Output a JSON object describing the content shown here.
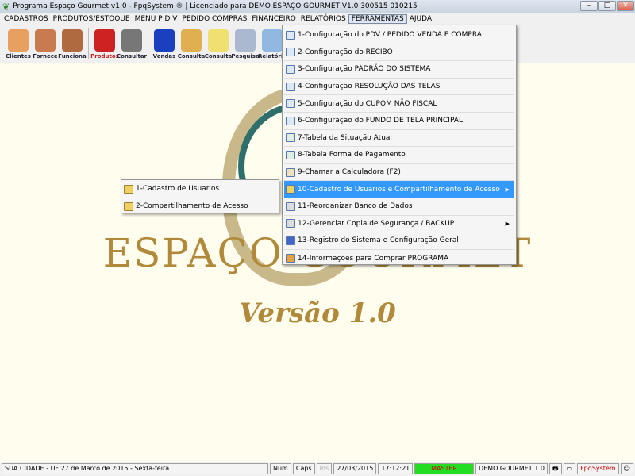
{
  "window": {
    "title": "Programa Espaço Gourmet v1.0 - FpqSystem ® | Licenciado para  DEMO ESPAÇO GOURMET V1.0 300515 010215",
    "min": "–",
    "max": "□",
    "close": "✕"
  },
  "menubar": [
    "CADASTROS",
    "PRODUTOS/ESTOQUE",
    "MENU P D V",
    "PEDIDO COMPRAS",
    "FINANCEIRO",
    "RELATÓRIOS",
    "FERRAMENTAS",
    "AJUDA"
  ],
  "toolbar": [
    {
      "label": "Clientes",
      "color": "#e8a060"
    },
    {
      "label": "Fornece",
      "color": "#c87a50"
    },
    {
      "label": "Funciona",
      "color": "#b06a40"
    },
    {
      "label": "Produtos",
      "color": "#cc2222"
    },
    {
      "label": "Consultar",
      "color": "#777777"
    },
    {
      "label": "Vendas",
      "color": "#1a3fbf"
    },
    {
      "label": "Consulta",
      "color": "#e0b050"
    },
    {
      "label": "Consulta",
      "color": "#f0e070"
    },
    {
      "label": "Pesquisa",
      "color": "#aab8d0"
    },
    {
      "label": "Relatório",
      "color": "#90b8e0"
    }
  ],
  "ferramentas_menu": [
    {
      "label": "1-Configuração do PDV / PEDIDO VENDA E COMPRA"
    },
    {
      "label": "2-Configuração do RECIBO"
    },
    {
      "label": "3-Configuração PADRÃO DO SISTEMA"
    },
    {
      "label": "4-Configuração RESOLUÇÃO DAS TELAS"
    },
    {
      "label": "5-Configuração do CUPOM NÃO FISCAL"
    },
    {
      "label": "6-Configuração do FUNDO DE TELA PRINCIPAL"
    },
    {
      "label": "7-Tabela da Situação Atual"
    },
    {
      "label": "8-Tabela Forma de Pagamento"
    },
    {
      "label": "9-Chamar a Calculadora (F2)"
    },
    {
      "label": "10-Cadastro de Usuarios e Compartilhamento de Acesso",
      "submenu": true,
      "highlighted": true
    },
    {
      "label": "11-Reorganizar Banco de Dados"
    },
    {
      "label": "12-Gerenciar Copia de Segurança / BACKUP",
      "submenu": true
    },
    {
      "label": "13-Registro do Sistema e Configuração Geral"
    },
    {
      "label": "14-Informações para Comprar PROGRAMA"
    }
  ],
  "submenu": [
    "1-Cadastro de Usuarios",
    "2-Compartilhamento de Acesso"
  ],
  "brand": {
    "name": "ESPAÇO GOURMET",
    "version": "Versão 1.0"
  },
  "status": {
    "location": "SUA CIDADE - UF 27 de Marco de 2015 - Sexta-feira",
    "num": "Num",
    "caps": "Caps",
    "ins": "Ins",
    "date": "27/03/2015",
    "time": "17:12:21",
    "user": "MASTER",
    "company": "DEMO GOURMET 1.0",
    "vendor": "FpqSystem"
  },
  "colors": {
    "highlight": "#3399ff",
    "user_bg": "#22dd22",
    "brand": "#b08a3a"
  }
}
